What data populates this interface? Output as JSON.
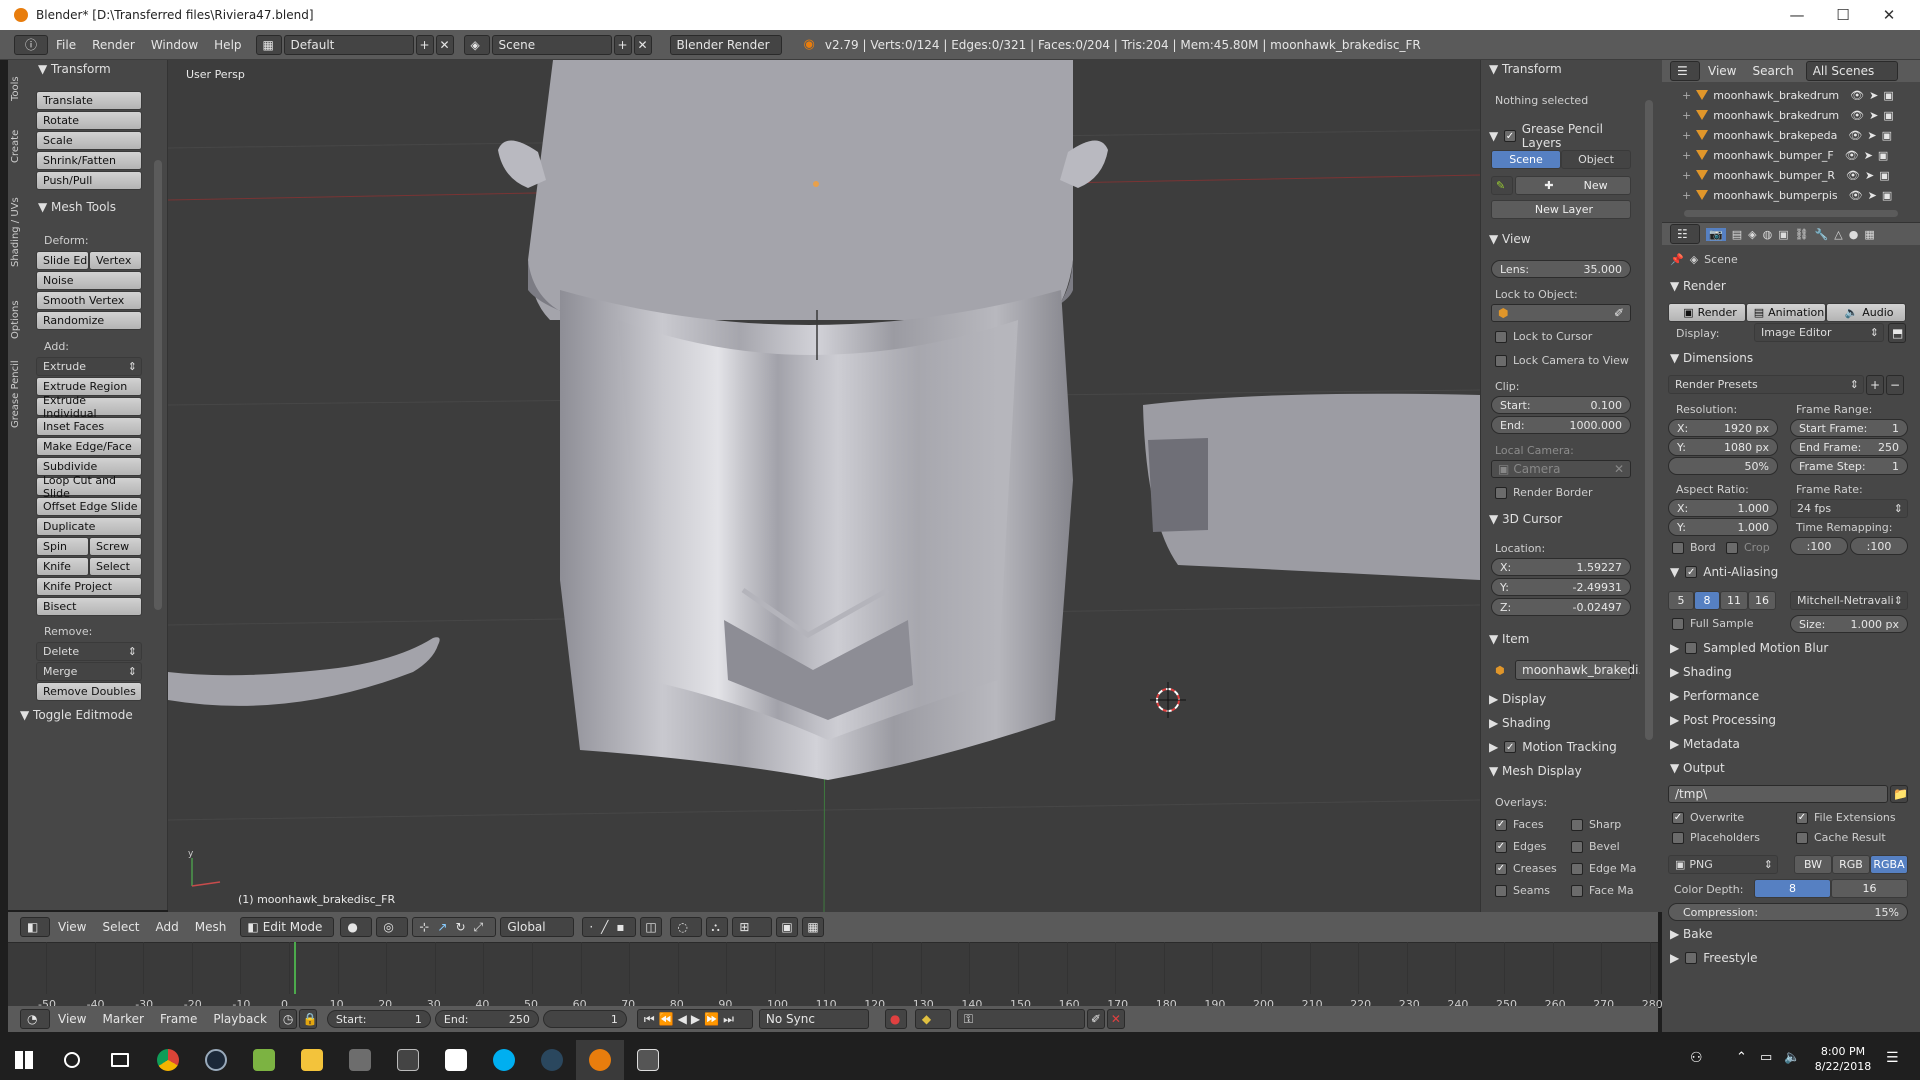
{
  "window": {
    "title": "Blender* [D:\\Transferred files\\Riviera47.blend]",
    "minimize": "—",
    "maximize": "☐",
    "close": "✕"
  },
  "topbar": {
    "menus": [
      "File",
      "Render",
      "Window",
      "Help"
    ],
    "layout": "Default",
    "scene": "Scene",
    "engine": "Blender Render",
    "stats": "v2.79 | Verts:0/124 | Edges:0/321 | Faces:0/204 | Tris:204 | Mem:45.80M | moonhawk_brakedisc_FR"
  },
  "lefttabs": [
    "Tools",
    "Create",
    "Shading / UVs",
    "Options",
    "Grease Pencil"
  ],
  "toolshelf": {
    "transform_title": "Transform",
    "transform": [
      "Translate",
      "Rotate",
      "Scale",
      "Shrink/Fatten",
      "Push/Pull"
    ],
    "meshtools_title": "Mesh Tools",
    "deform_label": "Deform:",
    "deform_pair": [
      "Slide Ed",
      "Vertex"
    ],
    "deform": [
      "Noise",
      "Smooth Vertex",
      "Randomize"
    ],
    "add_label": "Add:",
    "extrude_select": "Extrude",
    "add": [
      "Extrude Region",
      "Extrude Individual",
      "Inset Faces",
      "Make Edge/Face",
      "Subdivide",
      "Loop Cut and Slide",
      "Offset Edge Slide",
      "Duplicate"
    ],
    "spin_pair": [
      "Spin",
      "Screw"
    ],
    "knife_pair": [
      "Knife",
      "Select"
    ],
    "add2": [
      "Knife Project",
      "Bisect"
    ],
    "remove_label": "Remove:",
    "remove_selects": [
      "Delete",
      "Merge"
    ],
    "remove": [
      "Remove Doubles"
    ],
    "toggle": "Toggle Editmode"
  },
  "viewport": {
    "persp": "User Persp",
    "object": "(1) moonhawk_brakedisc_FR"
  },
  "npanel": {
    "transform_title": "Transform",
    "nothing": "Nothing selected",
    "gp_title": "Grease Pencil Layers",
    "gp_scene": "Scene",
    "gp_object": "Object",
    "gp_new": "New",
    "gp_newlayer": "New Layer",
    "view_title": "View",
    "lens_label": "Lens:",
    "lens": "35.000",
    "lock_label": "Lock to Object:",
    "lock_cursor": "Lock to Cursor",
    "lock_camera": "Lock Camera to View",
    "clip_label": "Clip:",
    "start_label": "Start:",
    "start": "0.100",
    "end_label": "End:",
    "end": "1000.000",
    "localcam_label": "Local Camera:",
    "camera": "Camera",
    "render_border": "Render Border",
    "cursor_title": "3D Cursor",
    "location_label": "Location:",
    "x_label": "X:",
    "x": "1.59227",
    "y_label": "Y:",
    "y": "-2.49931",
    "z_label": "Z:",
    "z": "-0.02497",
    "item_title": "Item",
    "item_name": "moonhawk_brakedi...",
    "display": "Display",
    "shading": "Shading",
    "motion": "Motion Tracking",
    "meshdisplay": "Mesh Display",
    "overlays_label": "Overlays:",
    "overlays_left": [
      "Faces",
      "Edges",
      "Creases",
      "Seams"
    ],
    "overlays_right": [
      "Sharp",
      "Bevel",
      "Edge Ma",
      "Face Ma"
    ]
  },
  "outliner": {
    "view": "View",
    "search": "Search",
    "scenes": "All Scenes",
    "items": [
      "moonhawk_brakedrum",
      "moonhawk_brakedrum",
      "moonhawk_brakepeda",
      "moonhawk_bumper_F",
      "moonhawk_bumper_R",
      "moonhawk_bumperpis"
    ]
  },
  "props": {
    "scene": "Scene",
    "render_title": "Render",
    "render_btn": "Render",
    "anim_btn": "Animation",
    "audio_btn": "Audio",
    "display_label": "Display:",
    "display_value": "Image Editor",
    "dimensions_title": "Dimensions",
    "presets": "Render Presets",
    "resolution_label": "Resolution:",
    "res_x_label": "X:",
    "res_x": "1920 px",
    "res_y_label": "Y:",
    "res_y": "1080 px",
    "res_pct": "50%",
    "framerange_label": "Frame Range:",
    "start_frame_label": "Start Frame:",
    "start_frame": "1",
    "end_frame_label": "End Frame:",
    "end_frame": "250",
    "frame_step_label": "Frame Step:",
    "frame_step": "1",
    "aspect_label": "Aspect Ratio:",
    "asp_x_label": "X:",
    "asp_x": "1.000",
    "asp_y_label": "Y:",
    "asp_y": "1.000",
    "framerate_label": "Frame Rate:",
    "fps": "24 fps",
    "remap_label": "Time Remapping:",
    "remap_old": ":100",
    "remap_new": ":100",
    "bord": "Bord",
    "crop": "Crop",
    "aa_title": "Anti-Aliasing",
    "aa_samples": [
      "5",
      "8",
      "11",
      "16"
    ],
    "filter": "Mitchell-Netravali",
    "full_sample": "Full Sample",
    "size_label": "Size:",
    "size": "1.000 px",
    "motion_blur": "Sampled Motion Blur",
    "shading": "Shading",
    "performance": "Performance",
    "post": "Post Processing",
    "metadata": "Metadata",
    "output_title": "Output",
    "path": "/tmp\\",
    "overwrite": "Overwrite",
    "file_ext": "File Extensions",
    "placeholders": "Placeholders",
    "cache": "Cache Result",
    "format": "PNG",
    "bw": "BW",
    "rgb": "RGB",
    "rgba": "RGBA",
    "depth_label": "Color Depth:",
    "depth8": "8",
    "depth16": "16",
    "compression_label": "Compression:",
    "compression": "15%",
    "bake": "Bake",
    "freestyle": "Freestyle"
  },
  "vpheader": {
    "menus": [
      "View",
      "Select",
      "Add",
      "Mesh"
    ],
    "mode": "Edit Mode",
    "orientation": "Global"
  },
  "timeline": {
    "ticks": [
      "-50",
      "-40",
      "-30",
      "-20",
      "-10",
      "0",
      "10",
      "20",
      "30",
      "40",
      "50",
      "60",
      "70",
      "80",
      "90",
      "100",
      "110",
      "120",
      "130",
      "140",
      "150",
      "160",
      "170",
      "180",
      "190",
      "200",
      "210",
      "220",
      "230",
      "240",
      "250",
      "260",
      "270",
      "280"
    ],
    "current_frame_value": 1
  },
  "tlheader": {
    "menus": [
      "View",
      "Marker",
      "Frame",
      "Playback"
    ],
    "start_label": "Start:",
    "start": "1",
    "end_label": "End:",
    "end": "250",
    "current": "1",
    "sync": "No Sync"
  },
  "taskbar": {
    "time": "8:00 PM",
    "date": "8/22/2018"
  },
  "colors": {
    "accent": "#5680c2",
    "orange": "#e87d0d",
    "selected_blue": "#5680c2"
  }
}
